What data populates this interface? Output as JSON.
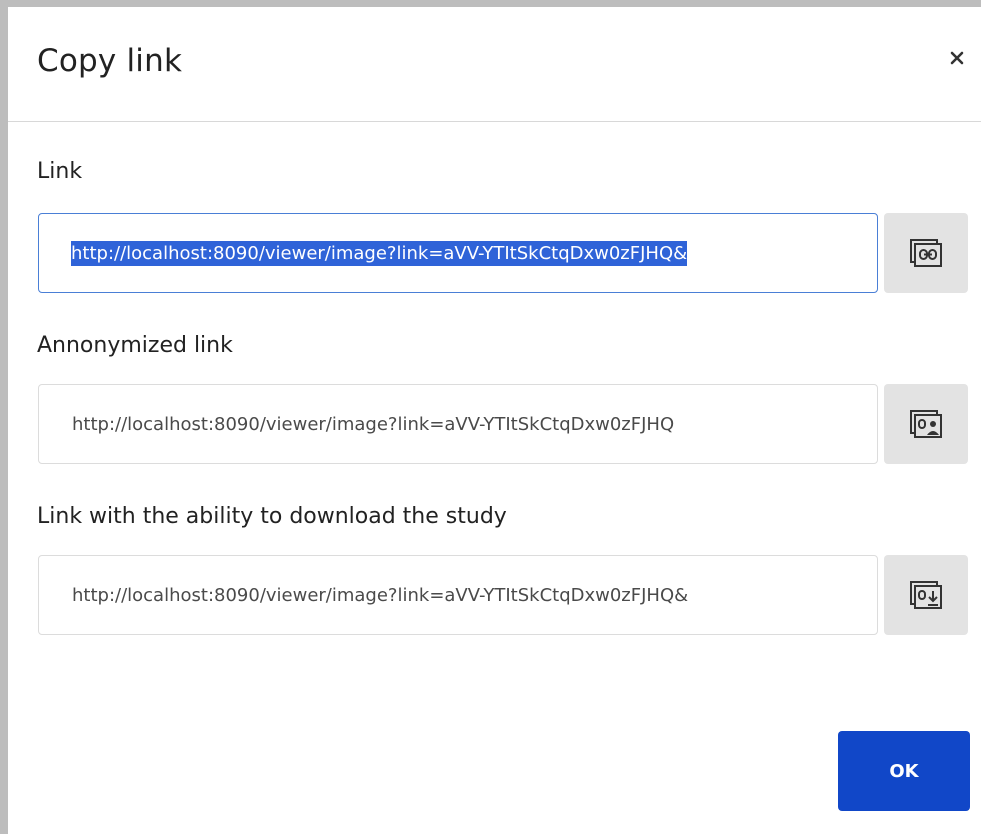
{
  "dialog": {
    "title": "Copy link",
    "close_icon": "close-icon",
    "ok_label": "OK"
  },
  "fields": {
    "link": {
      "label": "Link",
      "value": "http://localhost:8090/viewer/image?link=aVV-YTItSkCtqDxw0zFJHQ&",
      "copy_icon": "copy-link-icon"
    },
    "anonymized": {
      "label": "Annonymized link",
      "value": "http://localhost:8090/viewer/image?link=aVV-YTItSkCtqDxw0zFJHQ",
      "copy_icon": "copy-anonymized-link-icon"
    },
    "download": {
      "label": "Link with the ability to download the study",
      "value": "http://localhost:8090/viewer/image?link=aVV-YTItSkCtqDxw0zFJHQ&",
      "copy_icon": "copy-download-link-icon"
    }
  },
  "colors": {
    "primary": "#1147c8",
    "selection": "#2f63d8",
    "focus_border": "#4a7fd6",
    "button_bg": "#e3e3e3"
  }
}
